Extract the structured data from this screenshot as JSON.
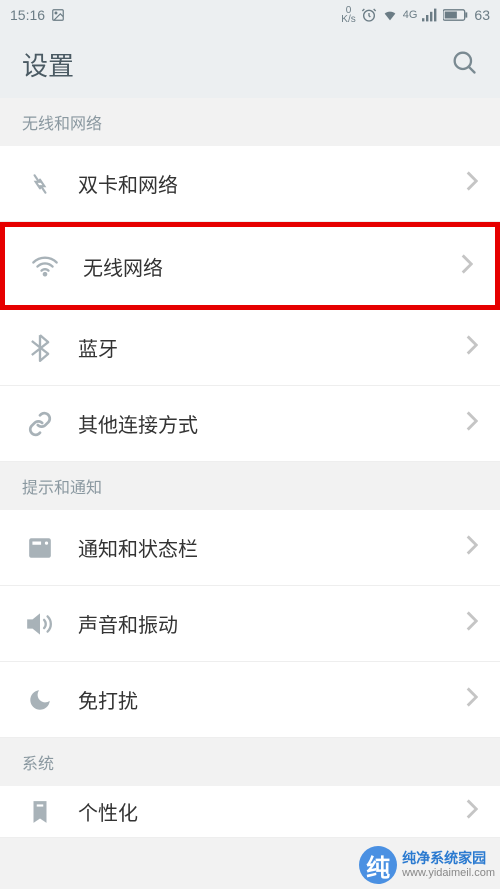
{
  "status_bar": {
    "time": "15:16",
    "net_speed_top": "0",
    "net_speed_unit": "K/s",
    "signal_type": "4G",
    "battery_percent": "63"
  },
  "header": {
    "title": "设置"
  },
  "sections": {
    "wireless": "无线和网络",
    "notifications": "提示和通知",
    "system": "系统"
  },
  "items": {
    "sim": "双卡和网络",
    "wifi": "无线网络",
    "bluetooth": "蓝牙",
    "other_connection": "其他连接方式",
    "notification_status": "通知和状态栏",
    "sound": "声音和振动",
    "dnd": "免打扰",
    "personalization": "个性化"
  },
  "watermark": {
    "label": "纯净系统家园",
    "url": "www.yidaimeil.com"
  }
}
